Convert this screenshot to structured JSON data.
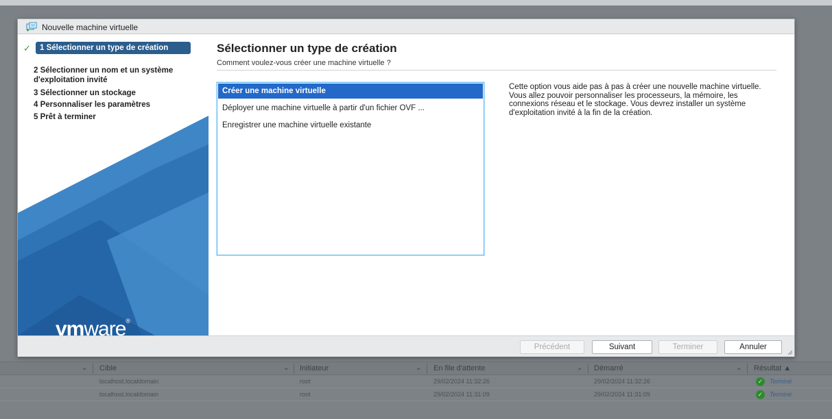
{
  "dialog": {
    "title": "Nouvelle machine virtuelle"
  },
  "steps": [
    {
      "label": "1 Sélectionner un type de création",
      "active": true,
      "done": true
    },
    {
      "label": "2 Sélectionner un nom et un système d'exploitation invité"
    },
    {
      "label": "3 Sélectionner un stockage"
    },
    {
      "label": "4 Personnaliser les paramètres"
    },
    {
      "label": "5 Prêt à terminer"
    }
  ],
  "brand": {
    "logo_bold": "vm",
    "logo_light": "ware",
    "logo_mark": "®"
  },
  "content": {
    "title": "Sélectionner un type de création",
    "subtitle": "Comment voulez-vous créer une machine virtuelle ?",
    "options": [
      {
        "label": "Créer une machine virtuelle",
        "selected": true
      },
      {
        "label": "Déployer une machine virtuelle à partir d'un fichier OVF ..."
      },
      {
        "label": "Enregistrer une machine virtuelle existante"
      }
    ],
    "description": "Cette option vous aide pas à pas à créer une nouvelle machine virtuelle. Vous allez pouvoir personnaliser les processeurs, la mémoire, les connexions réseau et le stockage. Vous devrez installer un système d'exploitation invité à la fin de la création."
  },
  "footer": {
    "previous_label": "Précédent",
    "next_label": "Suivant",
    "finish_label": "Terminer",
    "cancel_label": "Annuler"
  },
  "tasks_table": {
    "columns": [
      "Cible",
      "Initiateur",
      "En file d'attente",
      "Démarré",
      "Résultat ▲"
    ],
    "rows": [
      {
        "target": "localhost.localdomain",
        "initiator": "root",
        "queued": "29/02/2024 11:32:26",
        "started": "29/02/2024 11:32:26",
        "result": "Terminé"
      },
      {
        "target": "localhost.localdomain",
        "initiator": "root",
        "queued": "29/02/2024 11:31:09",
        "started": "29/02/2024 11:31:09",
        "result": "Terminé"
      }
    ]
  },
  "colors": {
    "accent": "#2468c8",
    "sidebar_active": "#2b5d8d",
    "success": "#3a9a2a"
  }
}
